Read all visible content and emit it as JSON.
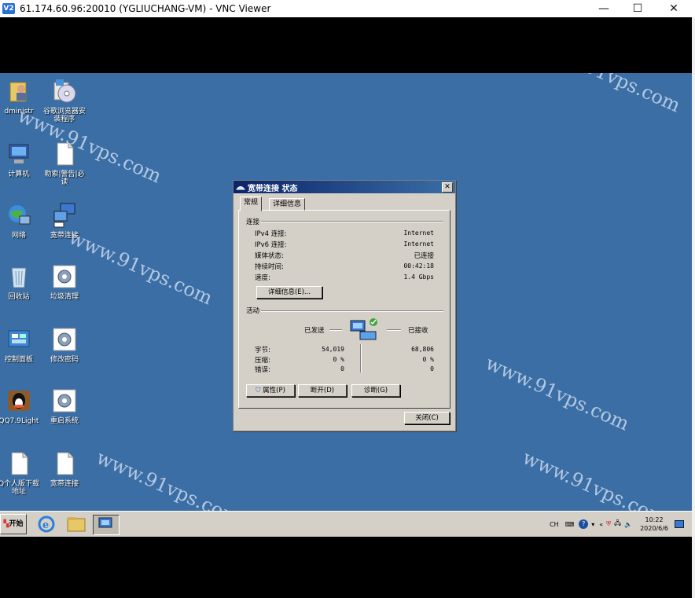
{
  "vnc": {
    "title": "61.174.60.96:20010 (YGLIUCHANG-VM) - VNC Viewer",
    "logo_text": "V2",
    "controls": {
      "minimize": "—",
      "maximize": "☐",
      "close": "✕"
    }
  },
  "desktop": {
    "icons": [
      {
        "label": "dministr",
        "icon": "user-folder-icon"
      },
      {
        "label": "谷歌浏览器安装程序",
        "icon": "installer-cd-icon"
      },
      {
        "label": "计算机",
        "icon": "computer-icon"
      },
      {
        "label": "勒索|警告|必读",
        "icon": "document-icon"
      },
      {
        "label": "网络",
        "icon": "network-globe-icon"
      },
      {
        "label": "宽带连接",
        "icon": "broadband-connection-icon"
      },
      {
        "label": "回收站",
        "icon": "recycle-bin-icon"
      },
      {
        "label": "垃圾清理",
        "icon": "gear-settings-icon"
      },
      {
        "label": "控制面板",
        "icon": "control-panel-icon"
      },
      {
        "label": "修改密码",
        "icon": "gear-settings-icon"
      },
      {
        "label": "QQ7.9Light",
        "icon": "qq-penguin-icon"
      },
      {
        "label": "重启系统",
        "icon": "gear-settings-icon"
      },
      {
        "label": "Q个人版下载地址",
        "icon": "document-icon"
      },
      {
        "label": "宽带连接",
        "icon": "document-icon"
      }
    ],
    "watermark": "www.91vps.com"
  },
  "dialog": {
    "title": "宽带连接 状态",
    "tabs": [
      "常规",
      "详细信息"
    ],
    "connection": {
      "group": "连接",
      "rows": [
        {
          "label": "IPv4 连接:",
          "value": "Internet"
        },
        {
          "label": "IPv6 连接:",
          "value": "Internet"
        },
        {
          "label": "媒体状态:",
          "value": "已连接"
        },
        {
          "label": "持续时间:",
          "value": "00:42:18"
        },
        {
          "label": "速度:",
          "value": "1.4 Gbps"
        }
      ],
      "details_button": "详细信息(E)..."
    },
    "activity": {
      "group": "活动",
      "sent_label": "已发送",
      "received_label": "已接收",
      "rows": [
        {
          "label": "字节:",
          "sent": "54,019",
          "received": "68,806"
        },
        {
          "label": "压缩:",
          "sent": "0 %",
          "received": "0 %"
        },
        {
          "label": "错误:",
          "sent": "0",
          "received": "0"
        }
      ]
    },
    "buttons": {
      "properties": "属性(P)",
      "disconnect": "断开(D)",
      "diagnose": "诊断(G)",
      "close": "关闭(C)"
    }
  },
  "taskbar": {
    "start": "开始",
    "lang": "CH",
    "time": "10:22",
    "date": "2020/6/6"
  }
}
